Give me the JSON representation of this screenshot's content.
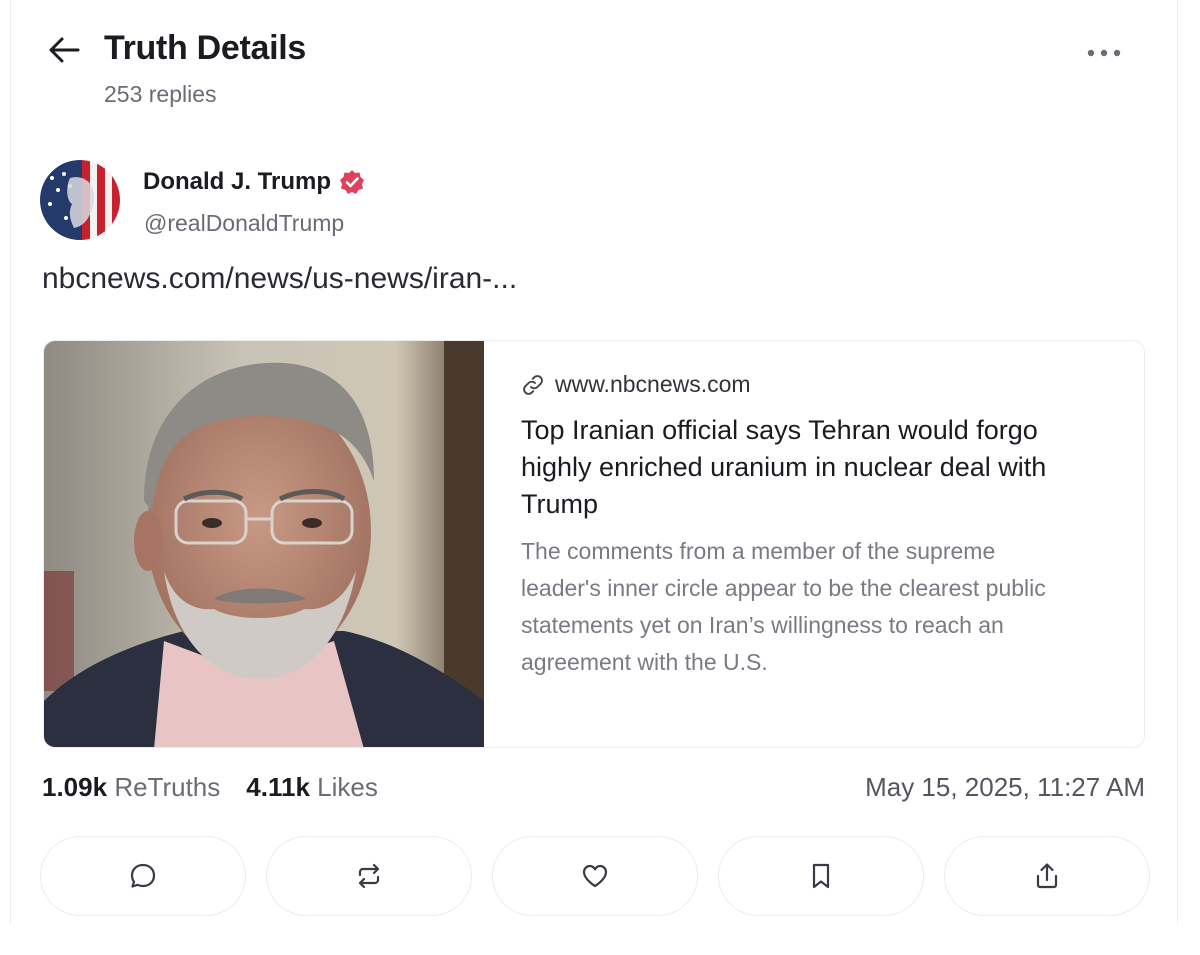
{
  "header": {
    "title": "Truth Details",
    "reply_count": "253 replies"
  },
  "post": {
    "author": {
      "name": "Donald J. Trump",
      "handle": "@realDonaldTrump",
      "verified": true
    },
    "link_text": "nbcnews.com/news/us-news/iran-...",
    "card": {
      "domain": "www.nbcnews.com",
      "title": "Top Iranian official says Tehran would forgo highly enriched uranium in nuclear deal with Trump",
      "description": "The comments from a member of the supreme leader's inner circle appear to be the clearest public statements yet on Iran’s willingness to reach an agreement with the U.S."
    },
    "stats": {
      "retruths_count": "1.09k",
      "retruths_label": "ReTruths",
      "likes_count": "4.11k",
      "likes_label": "Likes"
    },
    "timestamp": "May 15, 2025, 11:27 AM"
  },
  "actions": [
    "reply-icon",
    "retruth-icon",
    "heart-icon",
    "bookmark-icon",
    "share-icon"
  ],
  "colors": {
    "verified_badge": "#e0425d",
    "text_primary": "#1b1b22",
    "text_secondary": "#6b6b75",
    "border": "#ececef"
  }
}
